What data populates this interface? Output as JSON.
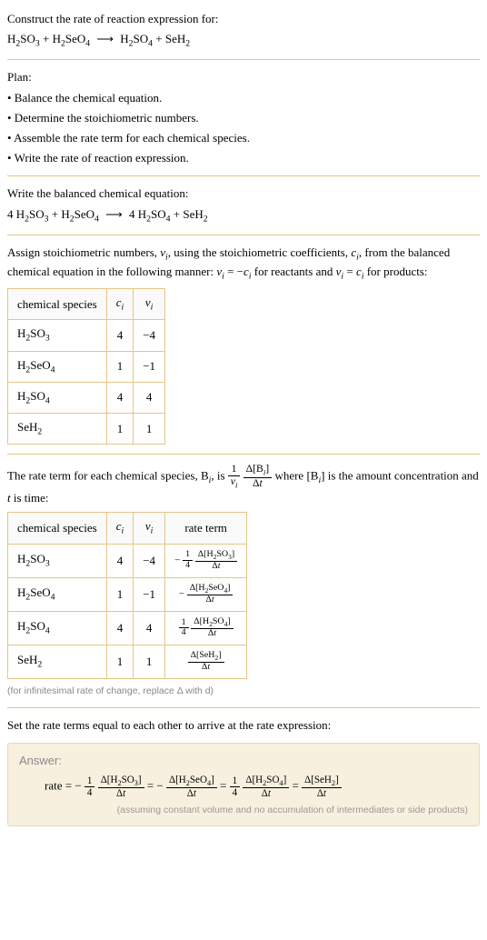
{
  "header": {
    "title": "Construct the rate of reaction expression for:",
    "eq_lhs1": "H",
    "eq_lhs1_sub": "2",
    "eq_lhs1b": "SO",
    "eq_lhs1b_sub": "3",
    "eq_plus1": "+",
    "eq_lhs2": "H",
    "eq_lhs2_sub": "2",
    "eq_lhs2b": "SeO",
    "eq_lhs2b_sub": "4",
    "eq_arrow": "⟶",
    "eq_rhs1": "H",
    "eq_rhs1_sub": "2",
    "eq_rhs1b": "SO",
    "eq_rhs1b_sub": "4",
    "eq_plus2": "+",
    "eq_rhs2": "SeH",
    "eq_rhs2_sub": "2"
  },
  "plan": {
    "label": "Plan:",
    "items": [
      "• Balance the chemical equation.",
      "• Determine the stoichiometric numbers.",
      "• Assemble the rate term for each chemical species.",
      "• Write the rate of reaction expression."
    ]
  },
  "balanced": {
    "label": "Write the balanced chemical equation:",
    "c1": "4",
    "c2": "4"
  },
  "assign": {
    "text_a": "Assign stoichiometric numbers, ",
    "nu": "ν",
    "i": "i",
    "text_b": ", using the stoichiometric coefficients, ",
    "c": "c",
    "text_c": ", from the balanced chemical equation in the following manner: ",
    "rel1": " = −",
    "text_d": " for reactants and ",
    "rel2": " = ",
    "text_e": " for products:"
  },
  "table1": {
    "h1": "chemical species",
    "h2": "c",
    "h2s": "i",
    "h3": "ν",
    "h3s": "i",
    "rows": [
      {
        "sp": "H2SO3",
        "c": "4",
        "v": "−4"
      },
      {
        "sp": "H2SeO4",
        "c": "1",
        "v": "−1"
      },
      {
        "sp": "H2SO4",
        "c": "4",
        "v": "4"
      },
      {
        "sp": "SeH2",
        "c": "1",
        "v": "1"
      }
    ]
  },
  "ratetext": {
    "a": "The rate term for each chemical species, B",
    "i": "i",
    "b": ", is ",
    "frac1_num": "1",
    "frac1_den_nu": "ν",
    "frac1_den_i": "i",
    "frac2_num_d": "Δ[B",
    "frac2_num_i": "i",
    "frac2_num_e": "]",
    "frac2_den": "Δt",
    "c": " where [B",
    "d": "] is the amount concentration and ",
    "t": "t",
    "e": " is time:"
  },
  "table2": {
    "h1": "chemical species",
    "h2": "c",
    "h2s": "i",
    "h3": "ν",
    "h3s": "i",
    "h4": "rate term",
    "rows": [
      {
        "sp": "H2SO3",
        "c": "4",
        "v": "−4",
        "sign": "−",
        "coef_num": "1",
        "coef_den": "4",
        "num": "Δ[H2SO3]",
        "den": "Δt"
      },
      {
        "sp": "H2SeO4",
        "c": "1",
        "v": "−1",
        "sign": "−",
        "coef_num": "",
        "coef_den": "",
        "num": "Δ[H2SeO4]",
        "den": "Δt"
      },
      {
        "sp": "H2SO4",
        "c": "4",
        "v": "4",
        "sign": "",
        "coef_num": "1",
        "coef_den": "4",
        "num": "Δ[H2SO4]",
        "den": "Δt"
      },
      {
        "sp": "SeH2",
        "c": "1",
        "v": "1",
        "sign": "",
        "coef_num": "",
        "coef_den": "",
        "num": "Δ[SeH2]",
        "den": "Δt"
      }
    ],
    "note": "(for infinitesimal rate of change, replace Δ with d)"
  },
  "setrate": "Set the rate terms equal to each other to arrive at the rate expression:",
  "answer": {
    "label": "Answer:",
    "rate": "rate",
    "eq": "=",
    "neg": "−",
    "q1_num": "1",
    "q1_den": "4",
    "t1_num": "Δ[H2SO3]",
    "t1_den": "Δt",
    "t2_num": "Δ[H2SeO4]",
    "t2_den": "Δt",
    "q3_num": "1",
    "q3_den": "4",
    "t3_num": "Δ[H2SO4]",
    "t3_den": "Δt",
    "t4_num": "Δ[SeH2]",
    "t4_den": "Δt",
    "note": "(assuming constant volume and no accumulation of intermediates or side products)"
  },
  "chart_data": {
    "type": "table",
    "title": "Stoichiometric numbers and rate terms",
    "species": [
      "H2SO3",
      "H2SeO4",
      "H2SO4",
      "SeH2"
    ],
    "c_i": [
      4,
      1,
      4,
      1
    ],
    "nu_i": [
      -4,
      -1,
      4,
      1
    ],
    "rate_terms": [
      "-(1/4) Δ[H2SO3]/Δt",
      "-Δ[H2SeO4]/Δt",
      "(1/4) Δ[H2SO4]/Δt",
      "Δ[SeH2]/Δt"
    ],
    "balanced_equation": "4 H2SO3 + H2SeO4 ⟶ 4 H2SO4 + SeH2",
    "rate_expression": "rate = -(1/4) Δ[H2SO3]/Δt = -Δ[H2SeO4]/Δt = (1/4) Δ[H2SO4]/Δt = Δ[SeH2]/Δt"
  }
}
